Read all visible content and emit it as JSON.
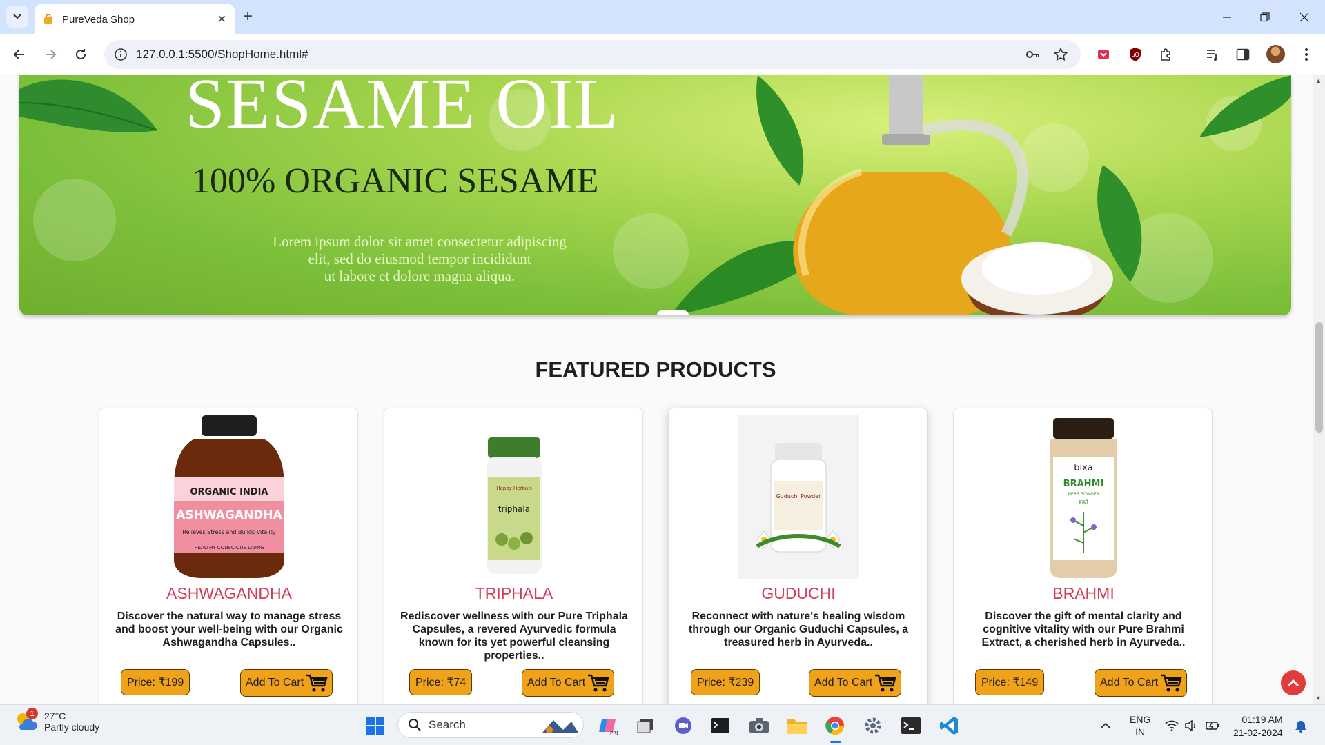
{
  "browser": {
    "tab_title": "PureVeda Shop",
    "new_tab_symbol": "+",
    "close_symbol": "✕",
    "url": "127.0.0.1:5500/ShopHome.html#"
  },
  "hero": {
    "title": "SESAME OIL",
    "subtitle": "100% ORGANIC SESAME",
    "text_line1": "Lorem ipsum dolor sit amet  consectetur adipiscing",
    "text_line2": "elit, sed do eiusmod tempor incididunt",
    "text_line3": "ut labore et dolore magna aliqua."
  },
  "section_title": "FEATURED PRODUCTS",
  "products": [
    {
      "name": "ASHWAGANDHA",
      "description": "Discover the natural way to manage stress and boost your well-being with our Organic Ashwagandha Capsules..",
      "price": "Price: ₹199",
      "cart_label": "Add To Cart",
      "jar_color": "#6b2a0c",
      "label_brand": "ORGANIC INDIA",
      "label_name": "ASHWAGANDHA",
      "label_tagline": "Relieves Stress and Builds Vitality",
      "label_footer": "HEALTHY CONSCIOUS LIVING"
    },
    {
      "name": "TRIPHALA",
      "description": "Rediscover wellness with our Pure Triphala Capsules, a revered Ayurvedic formula known for its yet powerful cleansing properties..",
      "price": "Price: ₹74",
      "cart_label": "Add To Cart",
      "jar_color": "#3e7d2b",
      "label_brand": "Happy Herbals",
      "label_name": "triphala"
    },
    {
      "name": "GUDUCHI",
      "description": "Reconnect with nature's healing wisdom through our Organic Guduchi Capsules, a treasured herb in Ayurveda..",
      "price": "Price: ₹239",
      "cart_label": "Add To Cart",
      "jar_color": "#f2f2f2",
      "label_name": "Guduchi Powder"
    },
    {
      "name": "BRAHMI",
      "description": "Discover the gift of mental clarity and cognitive vitality with our Pure Brahmi Extract, a cherished herb in Ayurveda..",
      "price": "Price: ₹149",
      "cart_label": "Add To Cart",
      "jar_color": "#2a1f12",
      "label_brand": "bixa",
      "label_name": "BRAHMI",
      "label_tagline": "HERB POWDER",
      "label_hindi": "ब्राह्मी"
    }
  ],
  "taskbar": {
    "weather_temp": "27°C",
    "weather_desc": "Partly cloudy",
    "weather_badge": "1",
    "search_label": "Search",
    "lang_line1": "ENG",
    "lang_line2": "IN",
    "time": "01:19 AM",
    "date": "21-02-2024"
  },
  "colors": {
    "accent_orange": "#f0a21a",
    "product_name": "#d13a5a",
    "back_to_top": "#e33a3a"
  }
}
